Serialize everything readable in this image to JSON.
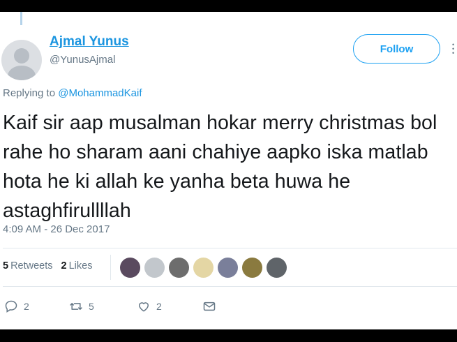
{
  "tweet": {
    "author_name": "Ajmal Yunus",
    "author_handle": "@YunusAjmal",
    "follow_label": "Follow",
    "replying_prefix": "Replying to",
    "replying_to": "@MohammadKaif",
    "text": "Kaif sir aap musalman hokar merry christmas bol rahe ho sharam aani chahiye aapko iska matlab hota he ki allah ke yanha beta huwa he astaghfirullllah",
    "timestamp": "4:09 AM - 26 Dec 2017"
  },
  "stats": {
    "retweets_count": "5",
    "retweets_label": "Retweets",
    "likes_count": "2",
    "likes_label": "Likes"
  },
  "liker_avatars": [
    {
      "color": "#5a4a5f"
    },
    {
      "color": "#c2c7cc"
    },
    {
      "color": "#6d6d6d"
    },
    {
      "color": "#e4d6a4"
    },
    {
      "color": "#7a7f9a"
    },
    {
      "color": "#8a7a3f"
    },
    {
      "color": "#5f6469"
    }
  ],
  "actions": {
    "reply_count": "2",
    "retweet_count": "5",
    "like_count": "2"
  },
  "colors": {
    "link": "#1b95e0",
    "button": "#1da1f2",
    "muted": "#657786",
    "text": "#14171a"
  },
  "icons": [
    "reply-icon",
    "retweet-icon",
    "like-icon",
    "message-icon"
  ]
}
